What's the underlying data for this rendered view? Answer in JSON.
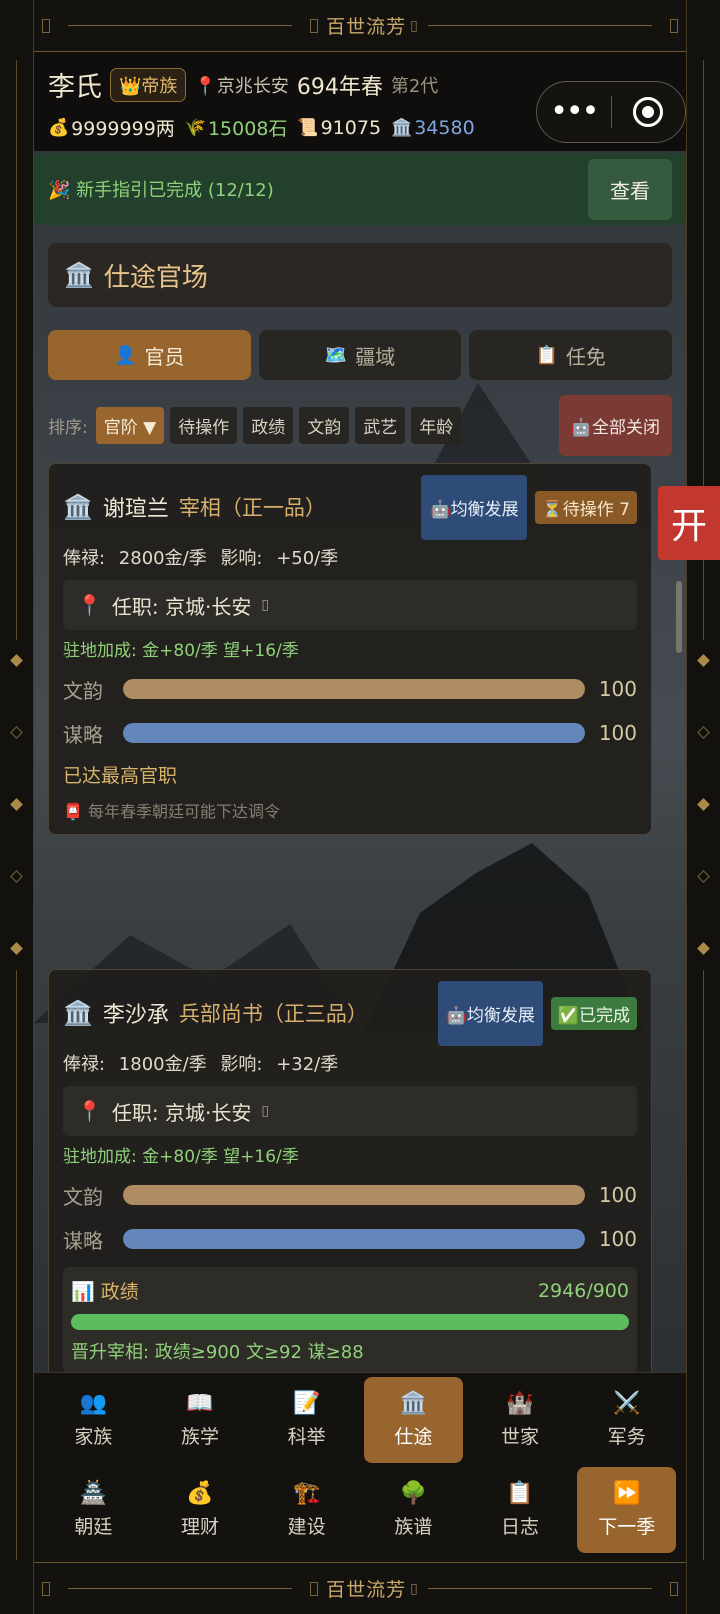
{
  "banner": {
    "title": "百世流芳"
  },
  "header": {
    "clan_name": "李氏",
    "rank_badge": "👑帝族",
    "location": "京兆长安",
    "year": "694年春",
    "generation": "第2代",
    "resources": [
      {
        "icon": "💰",
        "value": "9999999两"
      },
      {
        "icon": "🌾",
        "value": "15008石"
      },
      {
        "icon": "📜",
        "value": "91075"
      },
      {
        "icon": "🏛️",
        "value": "34580"
      }
    ]
  },
  "guide": {
    "text": "🎉 新手指引已完成 (12/12)",
    "button": "查看"
  },
  "section": {
    "title": "仕途官场"
  },
  "tabs": [
    {
      "icon": "👤",
      "label": "官员"
    },
    {
      "icon": "🗺️",
      "label": "疆域"
    },
    {
      "icon": "📋",
      "label": "任免"
    }
  ],
  "sort": {
    "label": "排序:",
    "options": [
      "官阶 ▼",
      "待操作",
      "政绩",
      "文韵",
      "武艺",
      "年龄"
    ],
    "close_all": "🤖全部关闭"
  },
  "officials": [
    {
      "name": "谢瑄兰",
      "title": "宰相（正一品）",
      "strategy": "🤖均衡发展",
      "status": "⏳待操作 7",
      "salary": "俸禄: 2800金/季",
      "influence": "影响: +50/季",
      "post": "任职: 京城·长安",
      "bonus": "驻地加成: 金+80/季  望+16/季",
      "stats": [
        {
          "label": "文韵",
          "value": 100
        },
        {
          "label": "谋略",
          "value": 100
        }
      ],
      "max_rank": "已达最高官职",
      "note": "📮 每年春季朝廷可能下达调令"
    },
    {
      "name": "李沙承",
      "title": "兵部尚书（正三品）",
      "strategy": "🤖均衡发展",
      "status": "✅已完成",
      "salary": "俸禄: 1800金/季",
      "influence": "影响: +32/季",
      "post": "任职: 京城·长安",
      "bonus": "驻地加成: 金+80/季  望+16/季",
      "stats": [
        {
          "label": "文韵",
          "value": 100
        },
        {
          "label": "谋略",
          "value": 100
        }
      ],
      "performance": {
        "label": "政绩",
        "value": "2946/900",
        "progress": 1.0
      },
      "promotion": "晋升宰相: 政绩≥900 文≥92 谋≥88"
    }
  ],
  "side_button": "开",
  "nav": {
    "row1": [
      {
        "icon": "👥",
        "label": "家族"
      },
      {
        "icon": "📖",
        "label": "族学"
      },
      {
        "icon": "📝",
        "label": "科举"
      },
      {
        "icon": "🏛️",
        "label": "仕途"
      },
      {
        "icon": "🏰",
        "label": "世家"
      },
      {
        "icon": "⚔️",
        "label": "军务"
      }
    ],
    "row2": [
      {
        "icon": "🏯",
        "label": "朝廷"
      },
      {
        "icon": "💰",
        "label": "理财"
      },
      {
        "icon": "🏗️",
        "label": "建设"
      },
      {
        "icon": "🌳",
        "label": "族谱"
      },
      {
        "icon": "📋",
        "label": "日志"
      },
      {
        "icon": "⏩",
        "label": "下一季"
      }
    ]
  }
}
